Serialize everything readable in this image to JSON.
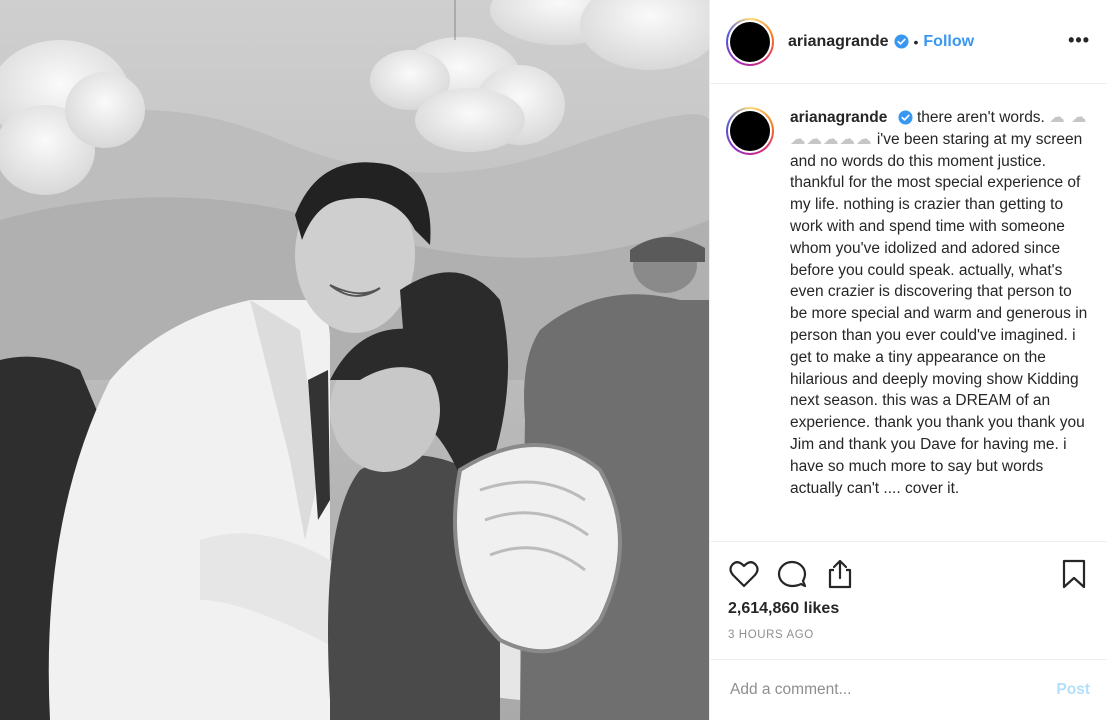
{
  "post": {
    "photo_alt": ""
  },
  "header": {
    "username": "arianagrande",
    "separator": "•",
    "follow_label": "Follow",
    "more_label": "•••"
  },
  "caption": {
    "username": "arianagrande",
    "text_start": "there aren't words.",
    "clouds": "☁\n☁☁☁☁☁☁",
    "text_rest": "i've been staring at my screen and no words do this moment justice. thankful for the most special experience of my life. nothing is crazier than getting to work with and spend time with someone whom you've idolized and adored since before you could speak. actually, what's even crazier is discovering that person to be more special and warm and generous in person than you ever could've imagined. i get to make a tiny appearance on the hilarious and deeply moving show Kidding next season. this was a DREAM of an experience. thank you thank you thank you Jim and thank you Dave for having me. i have so much more to say but words actually can't .... cover it."
  },
  "actions": {
    "likes": "2,614,860 likes",
    "time": "3 HOURS AGO"
  },
  "comment": {
    "placeholder": "Add a comment...",
    "post_label": "Post"
  },
  "colors": {
    "accent": "#3897f0",
    "post_disabled": "#b2dffc",
    "muted": "#8e8e8e"
  },
  "icons": [
    "verified-badge-icon",
    "more-icon",
    "heart-icon",
    "comment-icon",
    "share-icon",
    "bookmark-icon"
  ]
}
